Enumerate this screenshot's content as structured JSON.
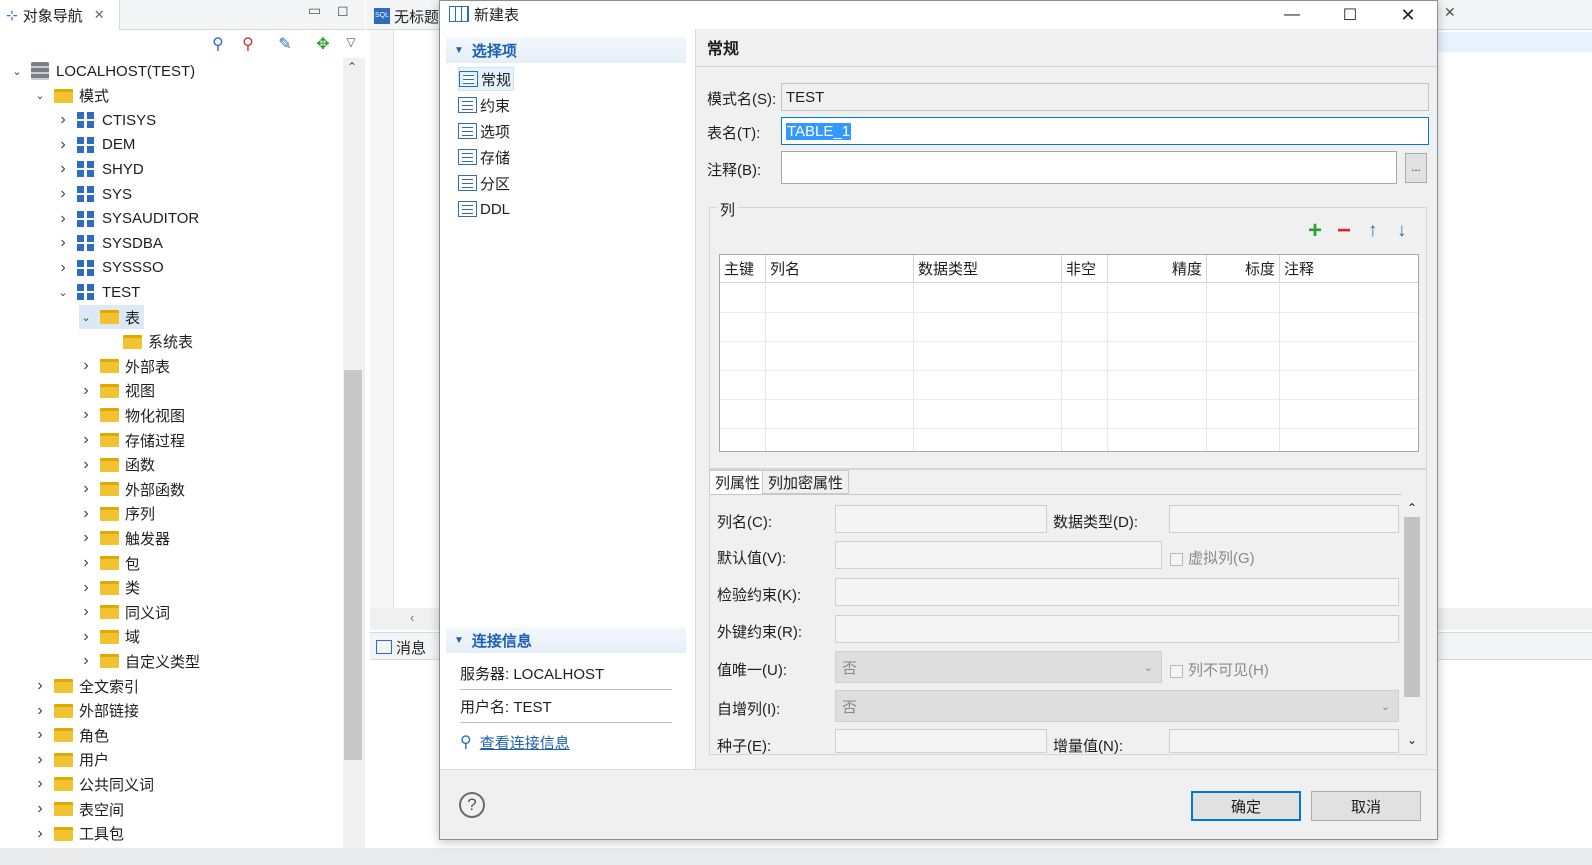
{
  "navigator": {
    "tab_title": "对象导航",
    "tree": [
      {
        "label": "LOCALHOST(TEST)",
        "icon": "server-icon",
        "level": 0,
        "expanded": true
      },
      {
        "label": "模式",
        "icon": "folder-icon",
        "level": 1,
        "expanded": true
      },
      {
        "label": "CTISYS",
        "icon": "schema-icon",
        "level": 2,
        "expanded": false
      },
      {
        "label": "DEM",
        "icon": "schema-icon",
        "level": 2,
        "expanded": false
      },
      {
        "label": "SHYD",
        "icon": "schema-icon",
        "level": 2,
        "expanded": false
      },
      {
        "label": "SYS",
        "icon": "schema-icon",
        "level": 2,
        "expanded": false
      },
      {
        "label": "SYSAUDITOR",
        "icon": "schema-icon",
        "level": 2,
        "expanded": false
      },
      {
        "label": "SYSDBA",
        "icon": "schema-icon",
        "level": 2,
        "expanded": false
      },
      {
        "label": "SYSSSO",
        "icon": "schema-icon",
        "level": 2,
        "expanded": false
      },
      {
        "label": "TEST",
        "icon": "schema-icon",
        "level": 2,
        "expanded": true
      },
      {
        "label": "表",
        "icon": "folder-icon",
        "level": 3,
        "expanded": true,
        "selected": true
      },
      {
        "label": "系统表",
        "icon": "folder-icon",
        "level": 4,
        "leaf": true
      },
      {
        "label": "外部表",
        "icon": "folder-icon",
        "level": 3,
        "expanded": false
      },
      {
        "label": "视图",
        "icon": "folder-icon",
        "level": 3,
        "expanded": false
      },
      {
        "label": "物化视图",
        "icon": "folder-icon",
        "level": 3,
        "expanded": false
      },
      {
        "label": "存储过程",
        "icon": "folder-icon",
        "level": 3,
        "expanded": false
      },
      {
        "label": "函数",
        "icon": "folder-icon",
        "level": 3,
        "expanded": false
      },
      {
        "label": "外部函数",
        "icon": "folder-icon",
        "level": 3,
        "expanded": false
      },
      {
        "label": "序列",
        "icon": "folder-icon",
        "level": 3,
        "expanded": false
      },
      {
        "label": "触发器",
        "icon": "folder-icon",
        "level": 3,
        "expanded": false
      },
      {
        "label": "包",
        "icon": "folder-icon",
        "level": 3,
        "expanded": false
      },
      {
        "label": "类",
        "icon": "folder-icon",
        "level": 3,
        "expanded": false
      },
      {
        "label": "同义词",
        "icon": "folder-icon",
        "level": 3,
        "expanded": false
      },
      {
        "label": "域",
        "icon": "folder-icon",
        "level": 3,
        "expanded": false
      },
      {
        "label": "自定义类型",
        "icon": "folder-icon",
        "level": 3,
        "expanded": false
      },
      {
        "label": "全文索引",
        "icon": "folder-icon",
        "level": 1,
        "expanded": false
      },
      {
        "label": "外部链接",
        "icon": "folder-icon",
        "level": 1,
        "expanded": false
      },
      {
        "label": "角色",
        "icon": "folder-icon",
        "level": 1,
        "expanded": false
      },
      {
        "label": "用户",
        "icon": "folder-icon",
        "level": 1,
        "expanded": false
      },
      {
        "label": "公共同义词",
        "icon": "folder-icon",
        "level": 1,
        "expanded": false
      },
      {
        "label": "表空间",
        "icon": "folder-icon",
        "level": 1,
        "expanded": false
      },
      {
        "label": "工具包",
        "icon": "folder-icon",
        "level": 1,
        "expanded": false
      }
    ]
  },
  "editor": {
    "tab_title": "无标题",
    "messages_tab": "消息"
  },
  "dialog": {
    "title": "新建表",
    "options_header": "选择项",
    "options": [
      "常规",
      "约束",
      "选项",
      "存储",
      "分区",
      "DDL"
    ],
    "connection_header": "连接信息",
    "server_text": "服务器: LOCALHOST",
    "user_text": "用户名: TEST",
    "view_conn_link": "查看连接信息",
    "page_title": "常规",
    "schema_label": "模式名(S):",
    "schema_value": "TEST",
    "table_label": "表名(T):",
    "table_value": "TABLE_1",
    "comment_label": "注释(B):",
    "comment_value": "",
    "browse_label": "...",
    "columns_group": "列",
    "columns_headers": [
      "主键",
      "列名",
      "数据类型",
      "非空",
      "精度",
      "标度",
      "注释"
    ],
    "prop_tabs": [
      "列属性",
      "列加密属性"
    ],
    "col_name_label": "列名(C):",
    "data_type_label": "数据类型(D):",
    "default_label": "默认值(V):",
    "virtual_label": "虚拟列(G)",
    "check_label": "检验约束(K):",
    "fk_label": "外键约束(R):",
    "unique_label": "值唯一(U):",
    "unique_value": "否",
    "invisible_label": "列不可见(H)",
    "identity_label": "自增列(I):",
    "identity_value": "否",
    "seed_label": "种子(E):",
    "increment_label": "增量值(N):",
    "ok_label": "确定",
    "cancel_label": "取消"
  },
  "colors": {
    "accent": "#1c5fb8",
    "selection": "#3399ff",
    "folder": "#f1c232",
    "add": "#2ca02c",
    "remove": "#d62728"
  }
}
